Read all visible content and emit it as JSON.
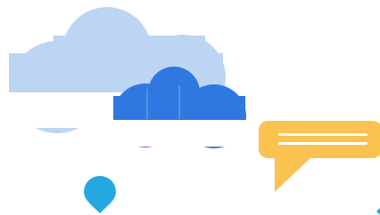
{
  "illustration": {
    "elements": [
      {
        "name": "large-cloud-icon",
        "color": "#bcd5f3"
      },
      {
        "name": "small-cloud-icon",
        "color": "#2f78e0"
      },
      {
        "name": "chat-bubble-icon",
        "color": "#fcc24f",
        "line_color": "#ffffff",
        "lines": 2
      },
      {
        "name": "location-pin-icon",
        "color": "#24a8e2"
      }
    ],
    "colors": {
      "background": "#ffffff",
      "cloud_light": "#bcd5f3",
      "cloud_dark": "#2f78e0",
      "chat_bubble": "#fcc24f",
      "pin": "#24a8e2"
    }
  }
}
